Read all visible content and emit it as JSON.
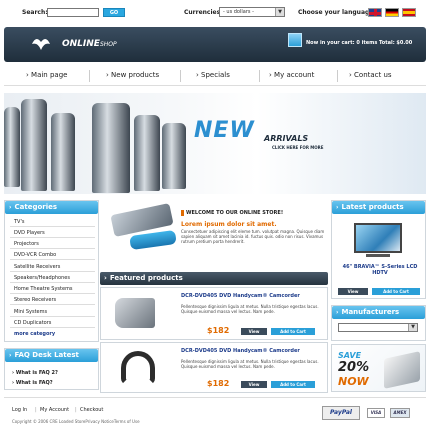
{
  "topbar": {
    "search_label": "Search:",
    "go_label": "GO",
    "currencies_label": "Currencies:",
    "currency_value": "- us dollars -",
    "language_label": "Choose your language:"
  },
  "header": {
    "logo_main": "ONLINE",
    "logo_sub": "SHOP",
    "cart_text": "Now in your cart: 0 items Total: $0.00"
  },
  "nav": [
    "Main page",
    "New products",
    "Specials",
    "My account",
    "Contact us"
  ],
  "banner": {
    "new": "NEW",
    "arrivals": "ARRIVALS",
    "clickhere": "CLICK HERE FOR MORE"
  },
  "categories": {
    "title": "Categories",
    "items": [
      "TV's",
      "DVD Players",
      "Projectors",
      "DVD-VCR Combo",
      "Satellite Receivers",
      "Speakers/Headphones",
      "Home Theatre Systems",
      "Stereo Receivers",
      "Mini Systems",
      "CD Duplicators",
      "more category"
    ]
  },
  "faq": {
    "title": "FAQ Desk Latest",
    "items": [
      "What is FAQ 2?",
      "What is FAQ?"
    ]
  },
  "welcome": {
    "title": "WELCOME TO OUR ONLINE STORE!",
    "lead": "Lorem ipsum dolor sit amet.",
    "text": "Consectetuer adipiscing elit eleme tum. volutpat magna. Quisque diam sapien aliquam sit amet lacinia id. fuctus quis. odio non risus. Vivamus rutrum pretium porta hendrerit."
  },
  "featured": {
    "title": "Featured products",
    "products": [
      {
        "name": "DCR-DVD405 DVD Handycam® Camcorder",
        "desc": "Pellentesque dignissim ligula at metus. Nulla tristique egestas lacus. Quisque euismod massa vel lectus. Nam pede.",
        "price": "$182",
        "view": "View",
        "cart": "Add to Cart"
      },
      {
        "name": "DCR-DVD405 DVD Handycam® Camcorder",
        "desc": "Pellentesque dignissim ligula at metus. Nulla tristique egestas lacus. Quisque euismod massa vel lectus. Nam pede.",
        "price": "$182",
        "view": "View",
        "cart": "Add to Cart"
      }
    ]
  },
  "latest": {
    "title": "Latest products",
    "product_name": "46\" BRAVIA™ S-Series LCD HDTV",
    "view": "View",
    "cart": "Add to Cart"
  },
  "manufacturers": {
    "title": "Manufacturers"
  },
  "promo": {
    "save": "SAVE",
    "percent": "20%",
    "now": "NOW"
  },
  "footer": {
    "links": [
      "Log In",
      "My Account",
      "Checkout"
    ],
    "copyright": "Copyright © 2006 CRE Loaded StorePrivacy NoticeTerms of Use",
    "payments": [
      "PayPal",
      "VISA",
      "AMEX"
    ]
  }
}
